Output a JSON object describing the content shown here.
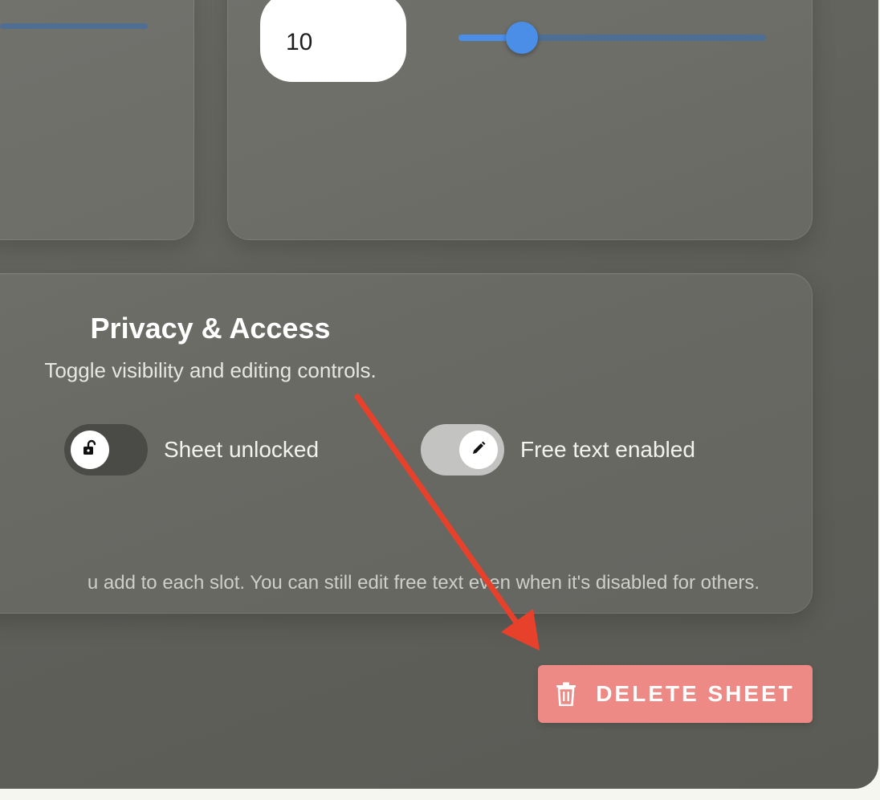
{
  "settings": {
    "number_input": {
      "value": "10"
    },
    "slider": {
      "value_fraction": 0.155
    }
  },
  "privacy": {
    "title": "Privacy & Access",
    "subtitle": "Toggle visibility and editing controls.",
    "lock_toggle": {
      "label": "Sheet unlocked",
      "state": "off",
      "icon": "unlock-icon"
    },
    "free_text_toggle": {
      "label": "Free text enabled",
      "state": "on",
      "icon": "pencil-icon"
    },
    "footnote": "u add to each slot. You can still edit free text even when it's disabled for others."
  },
  "actions": {
    "delete_label": "DELETE SHEET",
    "delete_icon": "trash-icon"
  },
  "colors": {
    "panel_bg": "#5f5f5a",
    "slider_accent": "#4a8ee8",
    "slider_track": "#4e6f93",
    "delete_button": "#ee8a85",
    "annotation_arrow": "#e8412b"
  }
}
